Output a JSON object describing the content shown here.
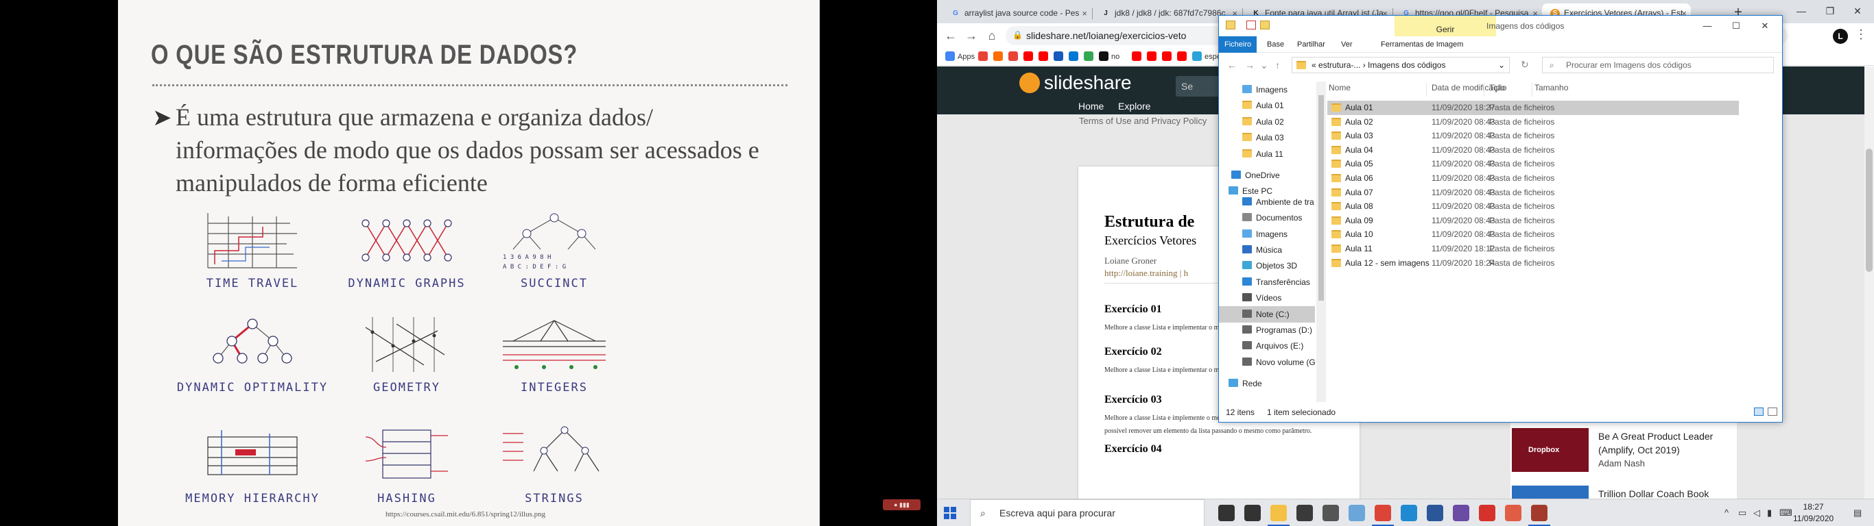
{
  "slide": {
    "title": "O QUE SÃO ESTRUTURA DE DADOS?",
    "bullet": "É uma estrutura que armazena e organiza dados/ informações de modo que os dados possam ser acessados e manipulados de forma eficiente",
    "topics": [
      "TIME TRAVEL",
      "DYNAMIC GRAPHS",
      "SUCCINCT",
      "DYNAMIC OPTIMALITY",
      "GEOMETRY",
      "INTEGERS",
      "MEMORY HIERARCHY",
      "HASHING",
      "STRINGS"
    ],
    "succinct_sketch_text": [
      "1 3 6 A 9 8 H",
      "A B C : D E F : G"
    ],
    "caption": "https://courses.csail.mit.edu/6.851/spring12/illus.png"
  },
  "browser": {
    "tabs": [
      {
        "title": "arraylist java source code - Pes",
        "favicon": "G",
        "active": false
      },
      {
        "title": "jdk8 / jdk8 / jdk: 687fd7c7986c",
        "favicon": "J",
        "active": false
      },
      {
        "title": "Fonte para java.util.ArrayList (Ja",
        "favicon": "K",
        "active": false
      },
      {
        "title": "https://goo.gl/0Fhelf - Pesquisa",
        "favicon": "G",
        "active": false
      },
      {
        "title": "Exercícios Vetores (Arrays) - Est",
        "favicon": "S",
        "active": true
      }
    ],
    "new_tab": "+",
    "url": "slideshare.net/loianeg/exercicios-veto",
    "profile_initial": "L",
    "bookmarks": [
      {
        "label": "Apps",
        "color": "#4285f4"
      },
      {
        "label": "",
        "color": "#e94235"
      },
      {
        "label": "",
        "color": "#ff6d00"
      },
      {
        "label": "",
        "color": "#ea4335"
      },
      {
        "label": "",
        "color": "#ff0000"
      },
      {
        "label": "",
        "color": "#ff0000"
      },
      {
        "label": "",
        "color": "#185abd"
      },
      {
        "label": "",
        "color": "#0078d4"
      },
      {
        "label": "",
        "color": "#34a853"
      },
      {
        "label": "no",
        "color": "#111111"
      },
      {
        "label": "",
        "color": "#ff0000"
      },
      {
        "label": "",
        "color": "#ff0000"
      },
      {
        "label": "",
        "color": "#ff0000"
      },
      {
        "label": "",
        "color": "#ff0000"
      },
      {
        "label": "espe",
        "color": "#2aa3d8"
      }
    ],
    "page": {
      "logo": "slideshare",
      "search_stub": "Se",
      "nav": [
        "Home",
        "Explore"
      ],
      "cookie_text": "Terms of Use and Privacy Policy",
      "doc": {
        "title": "Estrutura de",
        "subtitle": "Exercícios Vetores",
        "author": "Loiane Groner",
        "link": "http://loiane.training | h",
        "exercises": [
          {
            "heading": "Exercício 01",
            "text": "Melhore a classe Lista e implementar o método contem como na classe ArrayList."
          },
          {
            "heading": "Exercício 02",
            "text": "Melhore a classe Lista e implementar o método como na classe ArrayList."
          },
          {
            "heading": "Exercício 03",
            "text": "Melhore a classe Lista e implemente o método remove(T elemento), onde será possível remover um elemento da lista passando o mesmo como parâmetro."
          },
          {
            "heading": "Exercício 04",
            "text": ""
          }
        ]
      },
      "sidebar": [
        {
          "thumb": "Dropbox",
          "title": "Be A Great Product Leader (Amplify, Oct 2019)",
          "author": "Adam Nash"
        },
        {
          "thumb": "",
          "title": "Trillion Dollar Coach Book",
          "author": ""
        }
      ]
    }
  },
  "explorer": {
    "ribbon_context": "Gerir",
    "window_title": "Imagens dos códigos",
    "ribbon_tabs": [
      "Ficheiro",
      "Base",
      "Partilhar",
      "Ver",
      "Ferramentas de Imagem"
    ],
    "path": [
      "estrutura-...",
      "Imagens dos códigos"
    ],
    "search_placeholder": "Procurar em Imagens dos códigos",
    "nav": [
      {
        "label": "Imagens",
        "icon": "images"
      },
      {
        "label": "Aula 01",
        "icon": "folder"
      },
      {
        "label": "Aula 02",
        "icon": "folder"
      },
      {
        "label": "Aula 03",
        "icon": "folder"
      },
      {
        "label": "Aula 11",
        "icon": "folder"
      },
      {
        "label": "OneDrive",
        "icon": "cloud"
      },
      {
        "label": "Este PC",
        "icon": "pc"
      },
      {
        "label": "Ambiente de tra",
        "icon": "desktop"
      },
      {
        "label": "Documentos",
        "icon": "docs"
      },
      {
        "label": "Imagens",
        "icon": "images"
      },
      {
        "label": "Música",
        "icon": "music"
      },
      {
        "label": "Objetos 3D",
        "icon": "3d"
      },
      {
        "label": "Transferências",
        "icon": "download"
      },
      {
        "label": "Vídeos",
        "icon": "video"
      },
      {
        "label": "Note (C:)",
        "icon": "drive"
      },
      {
        "label": "Programas  (D:)",
        "icon": "drive"
      },
      {
        "label": "Arquivos (E:)",
        "icon": "drive"
      },
      {
        "label": "Novo volume (G",
        "icon": "drive"
      },
      {
        "label": "Rede",
        "icon": "network"
      }
    ],
    "columns": [
      "Nome",
      "Data de modificação",
      "Tipo",
      "Tamanho"
    ],
    "rows": [
      {
        "name": "Aula 01",
        "date": "11/09/2020 18:27",
        "type": "Pasta de ficheiros"
      },
      {
        "name": "Aula 02",
        "date": "11/09/2020 08:43",
        "type": "Pasta de ficheiros"
      },
      {
        "name": "Aula 03",
        "date": "11/09/2020 08:43",
        "type": "Pasta de ficheiros"
      },
      {
        "name": "Aula 04",
        "date": "11/09/2020 08:43",
        "type": "Pasta de ficheiros"
      },
      {
        "name": "Aula 05",
        "date": "11/09/2020 08:43",
        "type": "Pasta de ficheiros"
      },
      {
        "name": "Aula 06",
        "date": "11/09/2020 08:43",
        "type": "Pasta de ficheiros"
      },
      {
        "name": "Aula 07",
        "date": "11/09/2020 08:43",
        "type": "Pasta de ficheiros"
      },
      {
        "name": "Aula 08",
        "date": "11/09/2020 08:43",
        "type": "Pasta de ficheiros"
      },
      {
        "name": "Aula 09",
        "date": "11/09/2020 08:43",
        "type": "Pasta de ficheiros"
      },
      {
        "name": "Aula 10",
        "date": "11/09/2020 08:43",
        "type": "Pasta de ficheiros"
      },
      {
        "name": "Aula 11",
        "date": "11/09/2020 18:12",
        "type": "Pasta de ficheiros"
      },
      {
        "name": "Aula 12 - sem imagens",
        "date": "11/09/2020 18:24",
        "type": "Pasta de ficheiros"
      }
    ],
    "status_count": "12 itens",
    "status_selected": "1 item selecionado"
  },
  "taskbar": {
    "search_placeholder": "Escreva aqui para procurar",
    "apps": [
      {
        "name": "cortana",
        "color": "#333333",
        "active": false
      },
      {
        "name": "task-view",
        "color": "#333333",
        "active": false
      },
      {
        "name": "file-explorer",
        "color": "#f4c144",
        "active": true
      },
      {
        "name": "store",
        "color": "#3a3a3a",
        "active": false
      },
      {
        "name": "calculator",
        "color": "#555555",
        "active": false
      },
      {
        "name": "explorer-2",
        "color": "#6aa6d9",
        "active": false
      },
      {
        "name": "chrome",
        "color": "#db4437",
        "active": true
      },
      {
        "name": "vscode",
        "color": "#1f8ad2",
        "active": false
      },
      {
        "name": "word",
        "color": "#2b579a",
        "active": false
      },
      {
        "name": "obs",
        "color": "#6b4ba3",
        "active": false
      },
      {
        "name": "acrobat",
        "color": "#d6322b",
        "active": false
      },
      {
        "name": "git",
        "color": "#e05d44",
        "active": false
      },
      {
        "name": "slides-viewer",
        "color": "#a33b2c",
        "active": true
      }
    ],
    "time": "18:27",
    "date": "11/09/2020"
  },
  "colors": {
    "slide_bg": "#f7f6f5",
    "topic_label": "#3a3a80",
    "explorer_accent": "#1979ca",
    "slideshare_orange": "#f49b22"
  }
}
